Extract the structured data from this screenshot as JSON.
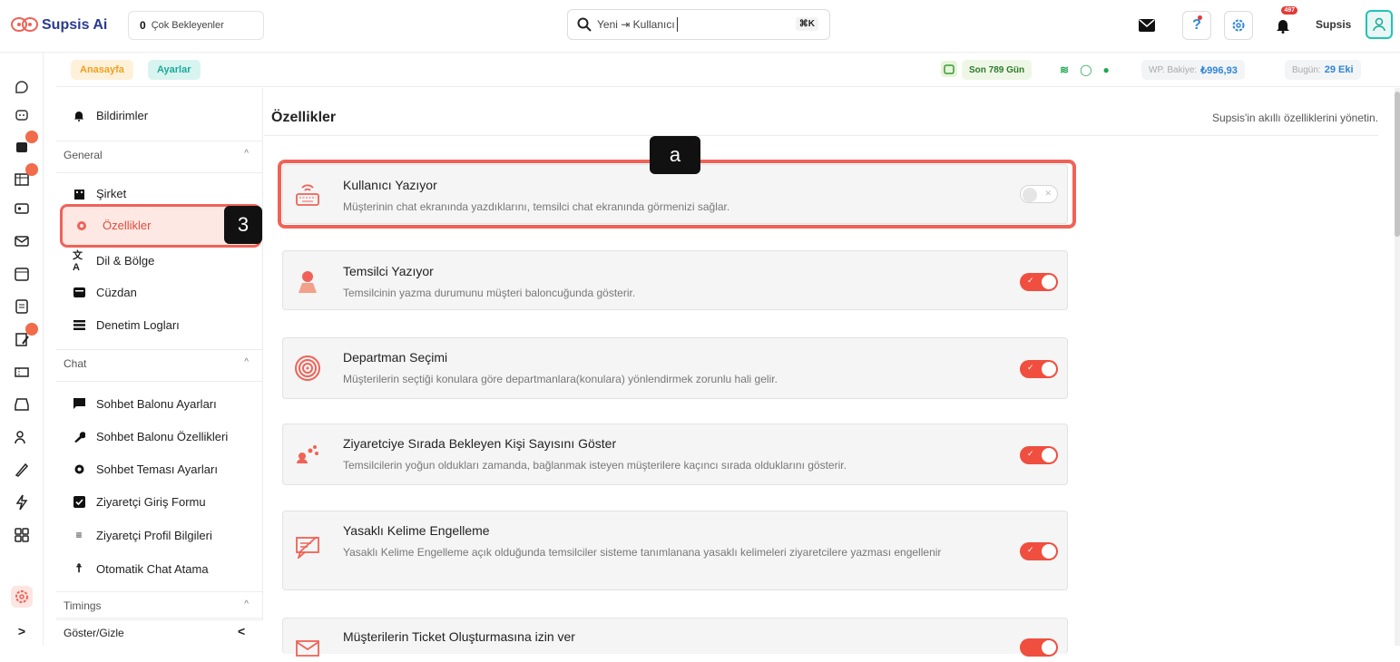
{
  "app": {
    "name": "Supsis Ai"
  },
  "topbar": {
    "pending_count": "0",
    "pending_label": "Çok Bekleyenler",
    "search_placeholder": "Yeni ⇥ Kullanıcı",
    "search_shortcut": "⌘K",
    "notification_count": "497",
    "user_name": "Supsis"
  },
  "breadcrumb": {
    "home": "Anasayfa",
    "settings": "Ayarlar"
  },
  "status": {
    "days_label": "Son 789 Gün",
    "balance_label": "WP. Bakiye:",
    "balance_value": "₺996,93",
    "today_label": "Bugün:",
    "today_value": "29 Eki"
  },
  "submenu": {
    "notifications": "Bildirimler",
    "general": {
      "label": "General",
      "items": {
        "company": "Şirket",
        "features": "Özellikler",
        "language": "Dil & Bölge",
        "wallet": "Cüzdan",
        "audit": "Denetim Logları"
      }
    },
    "chat": {
      "label": "Chat",
      "items": {
        "bubble_settings": "Sohbet Balonu Ayarları",
        "bubble_features": "Sohbet Balonu Özellikleri",
        "theme": "Sohbet Teması Ayarları",
        "entry_form": "Ziyaretçi Giriş Formu",
        "profile": "Ziyaretçi Profil Bilgileri",
        "auto_assign": "Otomatik Chat Atama"
      }
    },
    "timings": {
      "label": "Timings"
    },
    "toggle_label": "Göster/Gizle"
  },
  "main": {
    "title": "Özellikler",
    "subtitle": "Supsis'in akıllı özelliklerini yönetin.",
    "features": [
      {
        "title": "Kullanıcı Yazıyor",
        "desc": "Müşterinin chat ekranında yazdıklarını, temsilci chat ekranında görmenizi sağlar.",
        "enabled": false
      },
      {
        "title": "Temsilci Yazıyor",
        "desc": "Temsilcinin yazma durumunu müşteri baloncuğunda gösterir.",
        "enabled": true
      },
      {
        "title": "Departman Seçimi",
        "desc": "Müşterilerin seçtiği konulara göre departmanlara(konulara) yönlendirmek zorunlu hali gelir.",
        "enabled": true
      },
      {
        "title": "Ziyaretciye Sırada Bekleyen Kişi Sayısını Göster",
        "desc": "Temsilcilerin yoğun oldukları zamanda, bağlanmak isteyen müşterilere kaçıncı sırada olduklarını gösterir.",
        "enabled": true
      },
      {
        "title": "Yasaklı Kelime Engelleme",
        "desc": "Yasaklı Kelime Engelleme açık olduğunda temsilciler sisteme tanımlanana yasaklı kelimeleri ziyaretcilere yazması engellenir",
        "enabled": true
      },
      {
        "title": "Müşterilerin Ticket Oluşturmasına izin ver",
        "desc": "",
        "enabled": true
      }
    ]
  },
  "annotations": {
    "a": "a",
    "three": "3"
  },
  "colors": {
    "accent": "#f04e3e",
    "brand": "#2b3a8f",
    "teal": "#1aa99a",
    "highlight": "#f06257"
  }
}
